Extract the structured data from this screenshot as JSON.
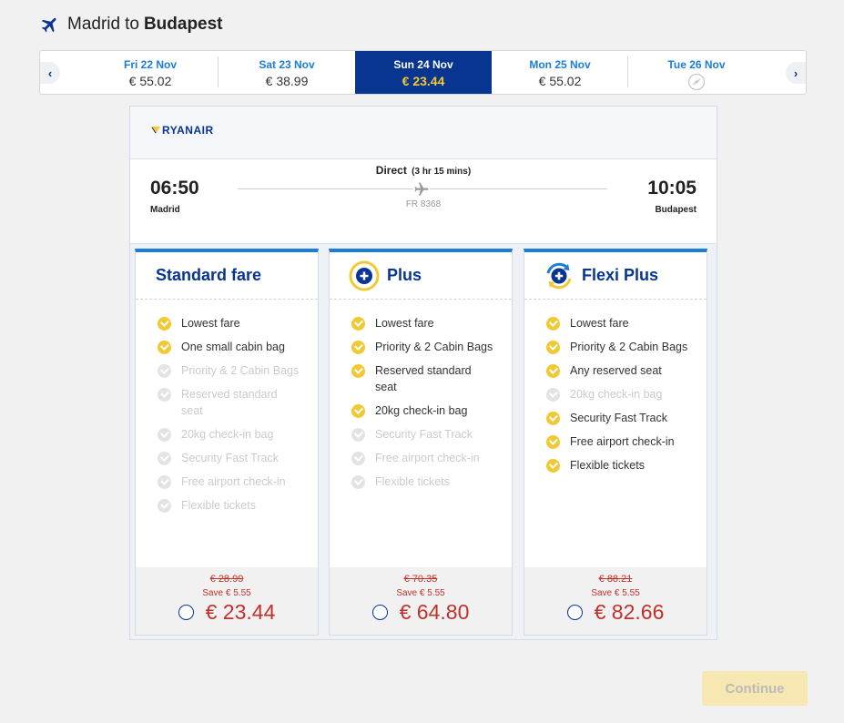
{
  "route": {
    "from": "Madrid",
    "connector": "to",
    "to": "Budapest"
  },
  "dates": [
    {
      "day": "Fri 22 Nov",
      "price": "€ 55.02",
      "selected": false
    },
    {
      "day": "Sat 23 Nov",
      "price": "€ 38.99",
      "selected": false
    },
    {
      "day": "Sun 24 Nov",
      "price": "€ 23.44",
      "selected": true
    },
    {
      "day": "Mon 25 Nov",
      "price": "€ 55.02",
      "selected": false
    },
    {
      "day": "Tue 26 Nov",
      "price": "",
      "selected": false,
      "icon": "no-flight-icon"
    }
  ],
  "flight": {
    "airline": "RYANAIR",
    "type": "Direct",
    "duration": "(3 hr 15 mins)",
    "flight_number": "FR 8368",
    "departure_time": "06:50",
    "departure_city": "Madrid",
    "arrival_time": "10:05",
    "arrival_city": "Budapest"
  },
  "fares": [
    {
      "name": "Standard fare",
      "icon": "",
      "features": [
        {
          "label": "Lowest fare",
          "included": true
        },
        {
          "label": "One small cabin bag",
          "included": true
        },
        {
          "label": "Priority & 2 Cabin Bags",
          "included": false
        },
        {
          "label": "Reserved standard seat",
          "included": false
        },
        {
          "label": "20kg check-in bag",
          "included": false
        },
        {
          "label": "Security Fast Track",
          "included": false
        },
        {
          "label": "Free airport check-in",
          "included": false
        },
        {
          "label": "Flexible tickets",
          "included": false
        }
      ],
      "old_price": "€ 28.99",
      "save": "Save  € 5.55",
      "price": "€ 23.44"
    },
    {
      "name": "Plus",
      "icon": "plus-icon",
      "features": [
        {
          "label": "Lowest fare",
          "included": true
        },
        {
          "label": "Priority & 2 Cabin Bags",
          "included": true
        },
        {
          "label": "Reserved standard seat",
          "included": true
        },
        {
          "label": "20kg check-in bag",
          "included": true
        },
        {
          "label": "Security Fast Track",
          "included": false
        },
        {
          "label": "Free airport check-in",
          "included": false
        },
        {
          "label": "Flexible tickets",
          "included": false
        }
      ],
      "old_price": "€ 70.35",
      "save": "Save  € 5.55",
      "price": "€ 64.80"
    },
    {
      "name": "Flexi Plus",
      "icon": "flexi-plus-icon",
      "features": [
        {
          "label": "Lowest fare",
          "included": true
        },
        {
          "label": "Priority & 2 Cabin Bags",
          "included": true
        },
        {
          "label": "Any reserved seat",
          "included": true
        },
        {
          "label": "20kg check-in bag",
          "included": false
        },
        {
          "label": "Security Fast Track",
          "included": true
        },
        {
          "label": "Free airport check-in",
          "included": true
        },
        {
          "label": "Flexible tickets",
          "included": true
        }
      ],
      "old_price": "€ 88.21",
      "save": "Save  € 5.55",
      "price": "€ 82.66"
    }
  ],
  "continue_label": "Continue",
  "colors": {
    "navy": "#073590",
    "yellow": "#f1c933",
    "blue": "#1a7dd8",
    "red": "#c0312b"
  }
}
